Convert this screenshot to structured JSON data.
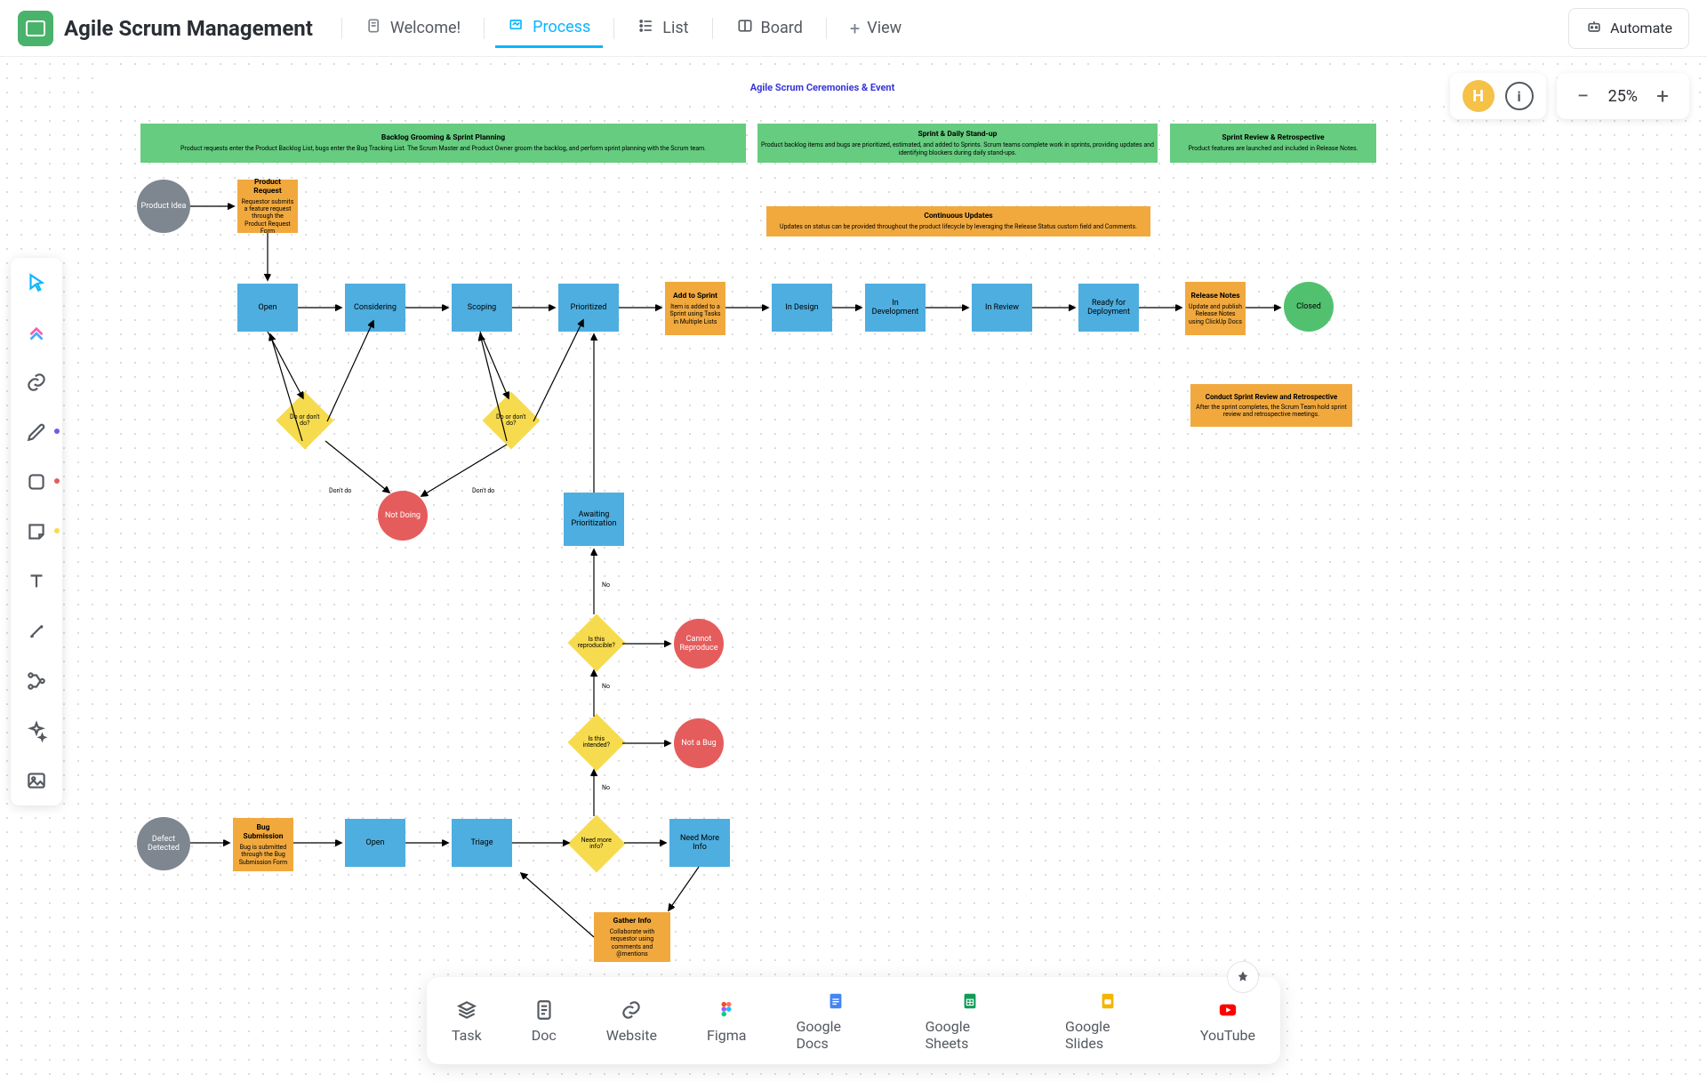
{
  "app": {
    "title": "Agile Scrum Management"
  },
  "nav": {
    "welcome": "Welcome!",
    "process": "Process",
    "list": "List",
    "board": "Board",
    "view": "View",
    "automate": "Automate"
  },
  "user": {
    "initial": "H"
  },
  "zoom": {
    "value": "25%"
  },
  "diagram": {
    "title": "Agile Scrum Ceremonies & Event",
    "banners": {
      "backlog": {
        "title": "Backlog Grooming & Sprint Planning",
        "sub": "Product requests enter the Product Backlog List, bugs enter the Bug Tracking List. The Scrum Master and Product Owner groom the backlog, and perform sprint planning with the Scrum team."
      },
      "sprint": {
        "title": "Sprint & Daily Stand-up",
        "sub": "Product backlog items and bugs are prioritized, estimated, and added to Sprints. Scrum teams complete work in sprints, providing updates and identifying blockers during daily stand-ups."
      },
      "review": {
        "title": "Sprint Review & Retrospective",
        "sub": "Product features are launched and included in Release Notes."
      },
      "updates": {
        "title": "Continuous Updates",
        "sub": "Updates on status can be provided throughout the product lifecycle by leveraging the Release Status custom field and Comments."
      },
      "retro": {
        "title": "Conduct Sprint Review and Retrospective",
        "sub": "After the sprint completes, the Scrum Team hold sprint review and retrospective meetings."
      }
    },
    "nodes": {
      "product_idea": "Product Idea",
      "product_request": {
        "title": "Product Request",
        "sub": "Requestor submits a feature request through the Product Request Form"
      },
      "open": "Open",
      "considering": "Considering",
      "scoping": "Scoping",
      "prioritized": "Prioritized",
      "add_to_sprint": {
        "title": "Add to Sprint",
        "sub": "Item is added to a Sprint using Tasks in Multiple Lists"
      },
      "in_design": "In Design",
      "in_development": "In Development",
      "in_review": "In Review",
      "ready_deploy": "Ready for Deployment",
      "release_notes": {
        "title": "Release Notes",
        "sub": "Update and publish Release Notes using ClickUp Docs"
      },
      "closed": "Closed",
      "do_dont1": "Do or don't do?",
      "do_dont2": "Do or don't do?",
      "not_doing": "Not Doing",
      "awaiting": "Awaiting Prioritization",
      "reproducible": "Is this reproducible?",
      "cannot_reproduce": "Cannot Reproduce",
      "intended": "Is this intended?",
      "not_bug": "Not a Bug",
      "defect": "Defect Detected",
      "bug_submission": {
        "title": "Bug Submission",
        "sub": "Bug is submitted through the Bug Submission Form"
      },
      "open2": "Open",
      "triage": "Triage",
      "need_info_d": "Need more info?",
      "need_info": "Need More Info",
      "gather_info": {
        "title": "Gather Info",
        "sub": "Collaborate with requestor using comments and @mentions"
      }
    },
    "edge_labels": {
      "dont_do": "Don't do",
      "no": "No"
    }
  },
  "bottom": {
    "task": "Task",
    "doc": "Doc",
    "website": "Website",
    "figma": "Figma",
    "gdocs": "Google Docs",
    "gsheets": "Google Sheets",
    "gslides": "Google Slides",
    "youtube": "YouTube"
  },
  "colors": {
    "green": "#66cc80",
    "blue": "#4eaee0",
    "orange": "#f1a93e",
    "yellow": "#f7db4e",
    "red": "#e55c5c",
    "gray": "#7e868f",
    "accent": "#0ab6ff"
  }
}
